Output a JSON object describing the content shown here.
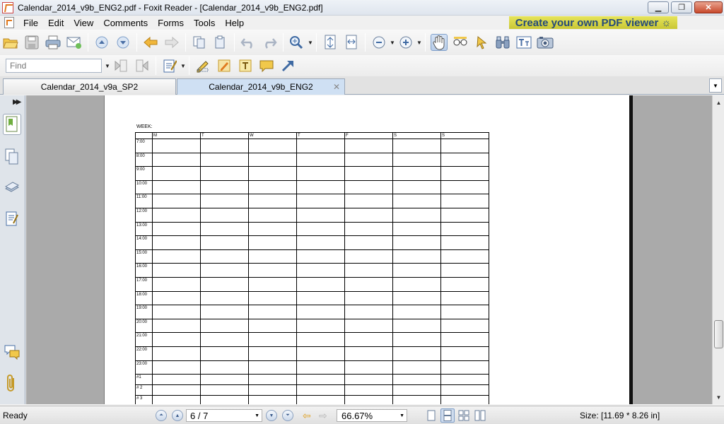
{
  "window": {
    "title": "Calendar_2014_v9b_ENG2.pdf - Foxit Reader - [Calendar_2014_v9b_ENG2.pdf]",
    "minimize": "▁",
    "maximize": "❐",
    "close": "✕"
  },
  "menu": {
    "items": [
      {
        "label": "File"
      },
      {
        "label": "Edit"
      },
      {
        "label": "View"
      },
      {
        "label": "Comments"
      },
      {
        "label": "Forms"
      },
      {
        "label": "Tools"
      },
      {
        "label": "Help"
      }
    ],
    "promo": "Create your own PDF viewer ☼"
  },
  "find": {
    "placeholder": "Find"
  },
  "tabs": [
    {
      "label": "Calendar_2014_v9a_SP2",
      "active": false
    },
    {
      "label": "Calendar_2014_v9b_ENG2",
      "active": true,
      "close": "✕"
    }
  ],
  "document": {
    "week_label": "WEEK:",
    "day_headers": [
      "M",
      "T",
      "W",
      "T",
      "F",
      "S",
      "S"
    ],
    "times": [
      "7:00",
      "8:00",
      "9:00",
      "10:00",
      "11:00",
      "12:00",
      "13:00",
      "14:00",
      "15:00",
      "16:00",
      "17:00",
      "18:00",
      "19:00",
      "20:00",
      "21:00",
      "22:00",
      "23:00"
    ],
    "extra_rows": [
      "#1",
      "# 2",
      "# 3"
    ]
  },
  "status": {
    "text": "Ready",
    "page": "6 / 7",
    "zoom": "66.67%",
    "size": "Size: [11.69 * 8.26 in]"
  },
  "colors": {
    "accent": "#7f9fc9",
    "promo_bg": "#d8d64a",
    "promo_text": "#254a7a",
    "page_bg": "#aaaaaa"
  }
}
